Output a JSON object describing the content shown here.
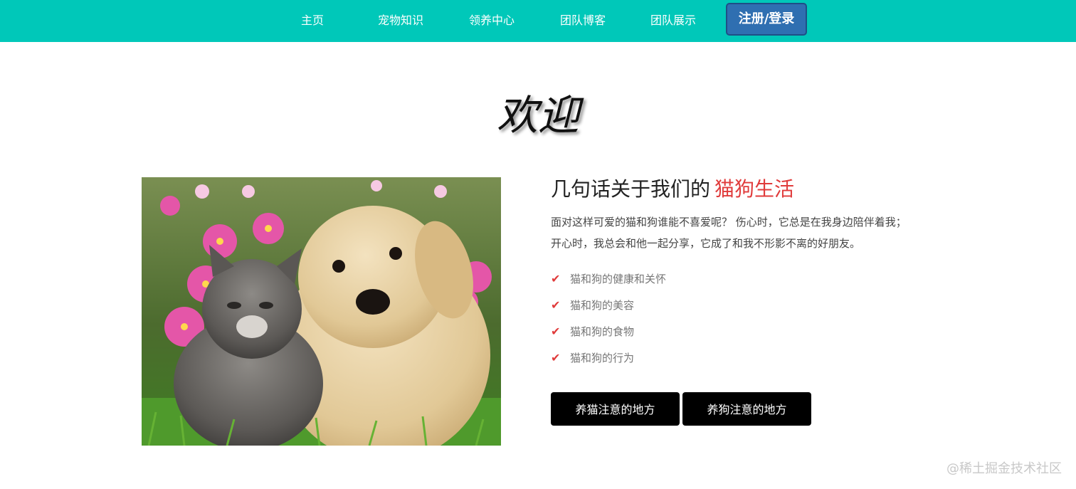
{
  "nav": {
    "items": [
      {
        "label": "主页"
      },
      {
        "label": "宠物知识"
      },
      {
        "label": "领养中心"
      },
      {
        "label": "团队博客"
      },
      {
        "label": "团队展示"
      }
    ],
    "login_label": "注册/登录"
  },
  "hero": {
    "welcome": "欢迎"
  },
  "about": {
    "title_prefix": "几句话关于我们的",
    "title_accent": "猫狗生活",
    "description_line1": "面对这样可爱的猫和狗谁能不喜爱呢？ 伤心时，它总是在我身边陪伴着我；",
    "description_line2": "开心时，我总会和他一起分享，它成了和我不形影不离的好朋友。",
    "features": [
      {
        "text": "猫和狗的健康和关怀"
      },
      {
        "text": "猫和狗的美容"
      },
      {
        "text": "猫和狗的食物"
      },
      {
        "text": "猫和狗的行为"
      }
    ],
    "buttons": {
      "cat_label": "养猫注意的地方",
      "dog_label": "养狗注意的地方"
    }
  },
  "image": {
    "subject": "kitten-and-puppy-photo"
  },
  "watermark": "@稀土掘金技术社区",
  "colors": {
    "nav_bg": "#00c8b9",
    "login_bg": "#2f6fb1",
    "accent": "#e03b3b",
    "button_bg": "#000000"
  },
  "icons": {
    "check": "check-icon"
  }
}
